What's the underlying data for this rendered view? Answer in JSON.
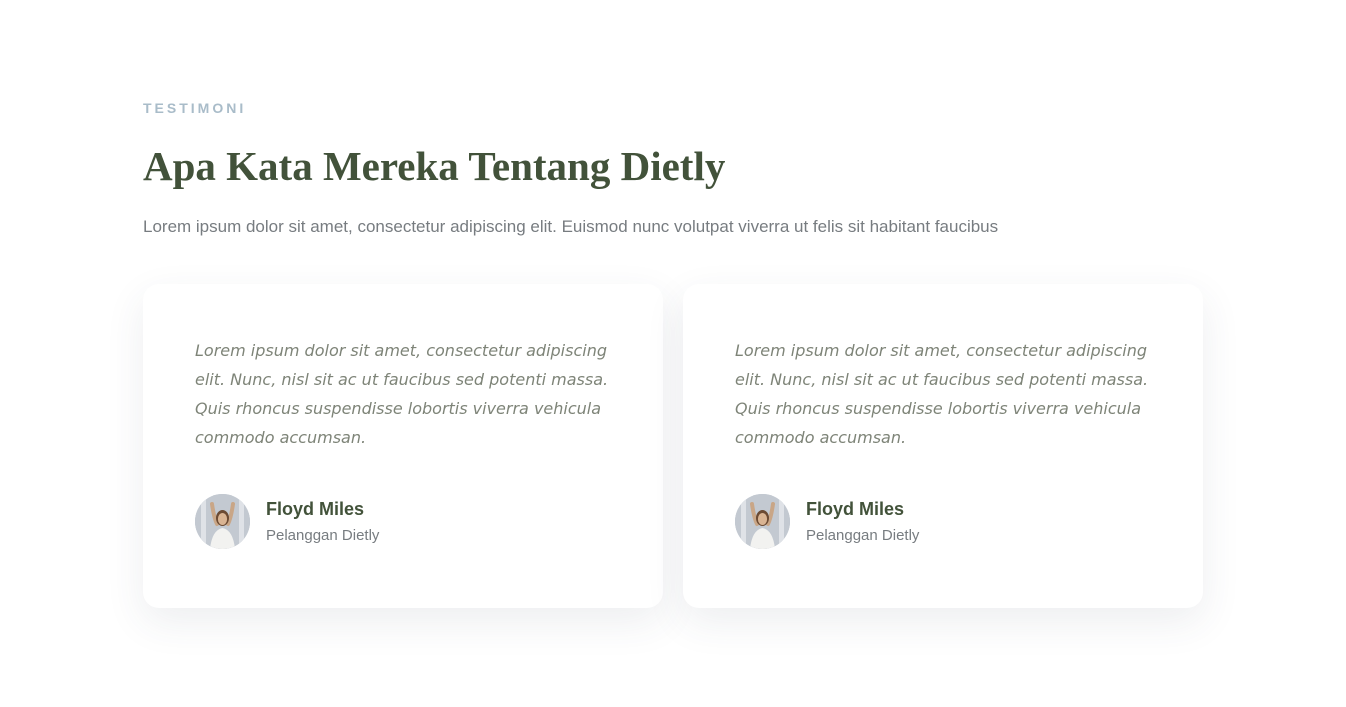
{
  "section": {
    "eyebrow": "TESTIMONI",
    "title": "Apa Kata Mereka Tentang Dietly",
    "subtitle": "Lorem ipsum dolor sit amet, consectetur adipiscing elit. Euismod nunc volutpat viverra ut felis sit habitant faucibus"
  },
  "testimonials": [
    {
      "quote": "Lorem ipsum dolor sit amet, consectetur adipiscing elit. Nunc, nisl sit ac ut faucibus sed potenti massa. Quis rhoncus suspendisse lobortis viverra vehicula commodo accumsan.",
      "name": "Floyd Miles",
      "role": "Pelanggan Dietly",
      "avatar_icon": "person-photo-avatar"
    },
    {
      "quote": "Lorem ipsum dolor sit amet, consectetur adipiscing elit. Nunc, nisl sit ac ut faucibus sed potenti massa. Quis rhoncus suspendisse lobortis viverra vehicula commodo accumsan.",
      "name": "Floyd Miles",
      "role": "Pelanggan Dietly",
      "avatar_icon": "person-photo-avatar"
    }
  ],
  "colors": {
    "heading": "#42523a",
    "eyebrow": "#a9bcc9",
    "body_text": "#777c80",
    "quote_text": "#7e8478",
    "background": "#ffffff"
  }
}
